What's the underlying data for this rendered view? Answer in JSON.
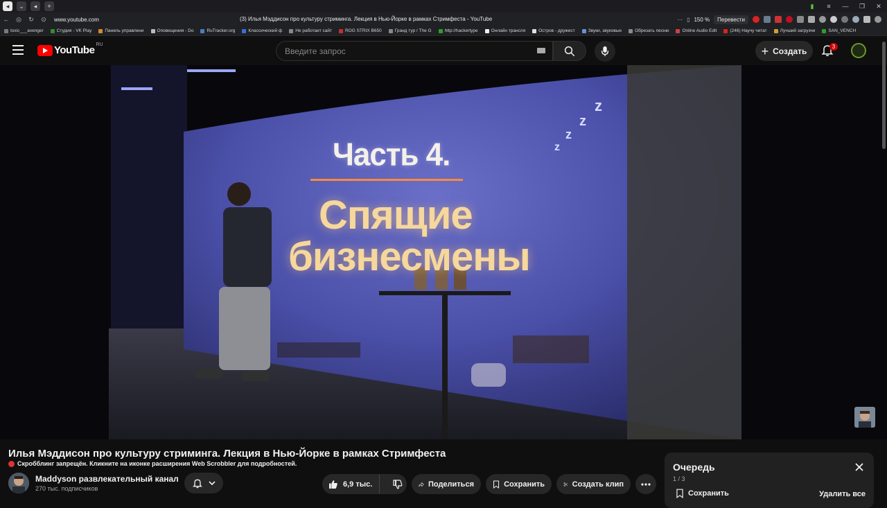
{
  "browser": {
    "url": "www.youtube.com",
    "tab_title": "(3) Илья Мэддисон про культуру стриминга. Лекция в Нью-Йорке в рамках Стримфеста - YouTube",
    "zoom": "150 %",
    "translate_label": "Перевести",
    "bookmarks": [
      {
        "label": "toxic___avenger",
        "color": "#7a7a7a"
      },
      {
        "label": "Студия - VK Play",
        "color": "#2f8f2f"
      },
      {
        "label": "Панель управлени",
        "color": "#d58a2a"
      },
      {
        "label": "Оповещения - Do",
        "color": "#bbbbbb"
      },
      {
        "label": "RuTracker.org",
        "color": "#4a7fc0"
      },
      {
        "label": "Классический ф",
        "color": "#3a6fd8"
      },
      {
        "label": "Не работает сайт",
        "color": "#888888"
      },
      {
        "label": "ROG STRIX B650",
        "color": "#c03030"
      },
      {
        "label": "Гранд тур / The G",
        "color": "#888888"
      },
      {
        "label": "http://hackertype",
        "color": "#2aa02a"
      },
      {
        "label": "Онлайн трансля",
        "color": "#f0f0f0"
      },
      {
        "label": "Остров - дружест",
        "color": "#e0e0e0"
      },
      {
        "label": "Звуки, звуковые",
        "color": "#6a8fd8"
      },
      {
        "label": "Обрезать песню",
        "color": "#8a8a8a"
      },
      {
        "label": "Online Audio Edit",
        "color": "#d04040"
      },
      {
        "label": "(246) Научу читат",
        "color": "#e02020"
      },
      {
        "label": "Лучший загрузчи",
        "color": "#d0a030"
      },
      {
        "label": "SAN_VENCH",
        "color": "#2aa02a"
      }
    ]
  },
  "header": {
    "logo_text": "YouTube",
    "country_code": "RU",
    "search_placeholder": "Введите запрос",
    "create_label": "Создать",
    "notification_count": "3"
  },
  "video": {
    "slide_title": "Часть 4.",
    "slide_line1": "Спящие",
    "slide_line2": "бизнесмены",
    "zzz": [
      "z",
      "z",
      "z",
      "z"
    ]
  },
  "info": {
    "title": "Илья Мэддисон про культуру стриминга. Лекция в Нью-Йорке в рамках Стримфеста",
    "scrobbler_note": "Скробблинг запрещён. Кликните на иконке расширения Web Scrobbler для подробностей.",
    "channel_name": "Maddyson развлекательный канал",
    "subscribers": "270 тыс. подписчиков",
    "likes": "6,9 тыс.",
    "share_label": "Поделиться",
    "save_label": "Сохранить",
    "clip_label": "Создать клип"
  },
  "queue": {
    "title": "Очередь",
    "position": "1 / 3",
    "save_label": "Сохранить",
    "remove_all_label": "Удалить все"
  },
  "colors": {
    "accent_red": "#ff0000",
    "background": "#0f0f0f",
    "pill": "#272727"
  }
}
